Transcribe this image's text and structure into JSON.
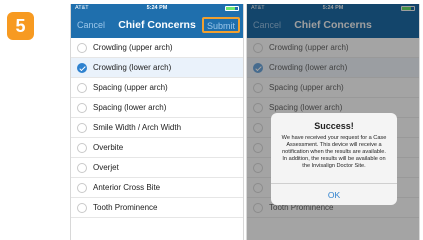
{
  "step_number": "5",
  "statusbar": {
    "carrier": "AT&T",
    "time": "5:24 PM"
  },
  "navbar": {
    "cancel_label": "Cancel",
    "title": "Chief Concerns",
    "submit_label": "Submit"
  },
  "concerns_left": [
    {
      "label": "Crowding (upper arch)",
      "selected": false
    },
    {
      "label": "Crowding (lower arch)",
      "selected": true
    },
    {
      "label": "Spacing (upper arch)",
      "selected": false
    },
    {
      "label": "Spacing (lower arch)",
      "selected": false
    },
    {
      "label": "Smile Width / Arch Width",
      "selected": false
    },
    {
      "label": "Overbite",
      "selected": false
    },
    {
      "label": "Overjet",
      "selected": false
    },
    {
      "label": "Anterior Cross Bite",
      "selected": false
    },
    {
      "label": "Tooth Prominence",
      "selected": false
    }
  ],
  "concerns_right": [
    {
      "label": "Crowding (upper arch)",
      "selected": false
    },
    {
      "label": "Crowding (lower arch)",
      "selected": true
    },
    {
      "label": "Spacing (upper arch)",
      "selected": false
    },
    {
      "label": "Spacing (lower arch)",
      "selected": false
    },
    {
      "label": "",
      "selected": false
    },
    {
      "label": "",
      "selected": false
    },
    {
      "label": "",
      "selected": false
    },
    {
      "label": "",
      "selected": false
    },
    {
      "label": "Tooth Prominence",
      "selected": false
    }
  ],
  "alert": {
    "title": "Success!",
    "message": "We have received your request for a Case Assessment. This device will receive a notification when the results are available. In addition, the results will be available on the Invisalign Doctor Site.",
    "ok_label": "OK"
  },
  "colors": {
    "nav_blue": "#1f6fad",
    "accent_orange": "#f79a21",
    "check_blue": "#2f82cf"
  }
}
